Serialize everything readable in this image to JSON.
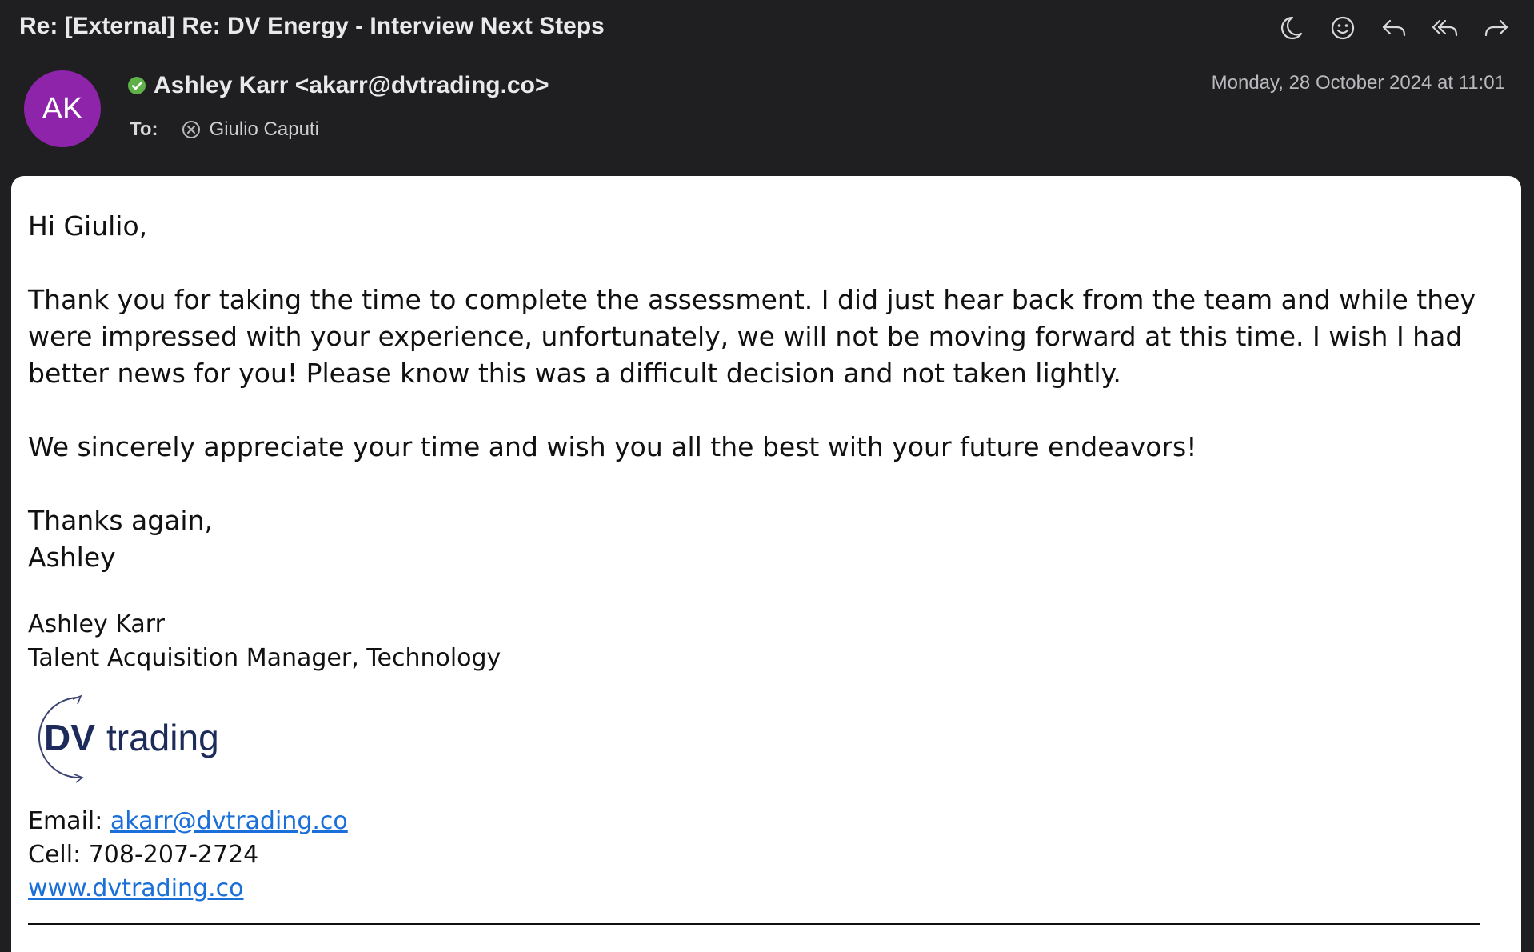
{
  "header": {
    "subject": "Re: [External] Re: DV Energy - Interview Next Steps",
    "avatar_initials": "AK",
    "sender": "Ashley Karr <akarr@dvtrading.co>",
    "to_label": "To:",
    "recipient": "Giulio Caputi",
    "date": "Monday, 28 October 2024 at 11:01",
    "toolbar": [
      "moon-icon",
      "smiley-icon",
      "reply-icon",
      "reply-all-icon",
      "forward-icon"
    ]
  },
  "body": {
    "greeting": "Hi Giulio,",
    "paragraph1": "Thank you for taking the time to complete the assessment. I did just hear back from the team and while they were impressed with your experience, unfortunately, we will not be moving forward at this time. I wish I had better news for you! Please know this was a difficult decision and not taken lightly.",
    "paragraph2": "We sincerely appreciate your time and wish you all the best with your future endeavors!",
    "closing": "Thanks again,",
    "sign_name": "Ashley"
  },
  "signature": {
    "name": "Ashley Karr",
    "title": "Talent Acquisition Manager, Technology",
    "logo_text_dv": "DV",
    "logo_text_trading": "trading",
    "email_label": "Email: ",
    "email": "akarr@dvtrading.co",
    "cell": "Cell: 708-207-2724",
    "website": "www.dvtrading.co"
  },
  "colors": {
    "header_bg": "#1f1f21",
    "avatar": "#8e24aa",
    "status": "#5fb048",
    "link": "#1a6fd8",
    "logo_navy": "#1d2b5a"
  }
}
